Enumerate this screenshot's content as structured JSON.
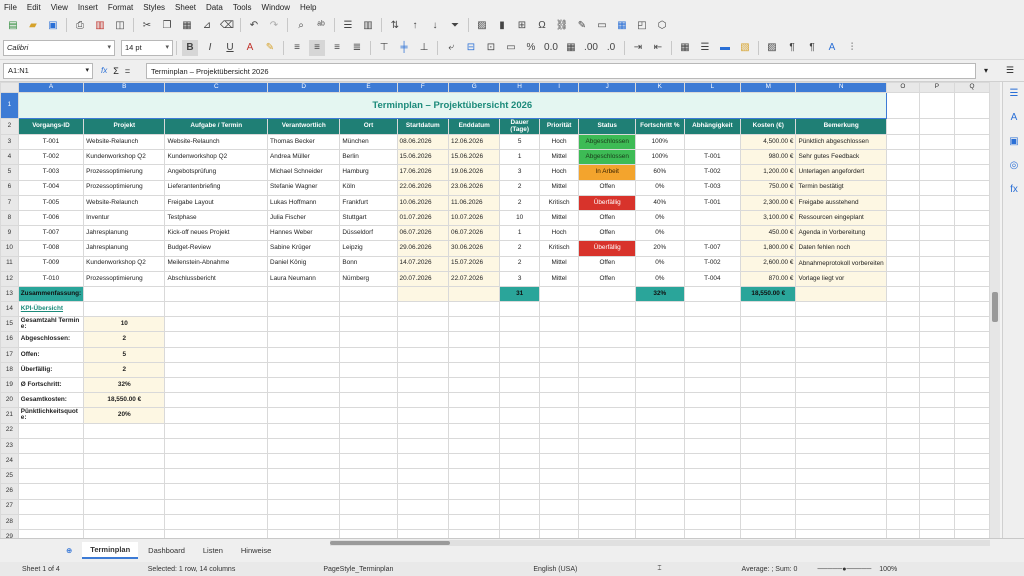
{
  "menu": [
    "File",
    "Edit",
    "View",
    "Insert",
    "Format",
    "Styles",
    "Sheet",
    "Data",
    "Tools",
    "Window",
    "Help"
  ],
  "font": {
    "name": "Calibri",
    "size": "14 pt"
  },
  "name_box": "A1:N1",
  "formula_text": "Terminplan – Projektübersicht 2026",
  "columns": [
    "A",
    "B",
    "C",
    "D",
    "E",
    "F",
    "G",
    "H",
    "I",
    "J",
    "K",
    "L",
    "M",
    "N",
    "O",
    "P",
    "Q"
  ],
  "title": "Terminplan – Projektübersicht 2026",
  "headers": [
    "Vorgangs-ID",
    "Projekt",
    "Aufgabe / Termin",
    "Verantwortlich",
    "Ort",
    "Startdatum",
    "Enddatum",
    "Dauer (Tage)",
    "Priorität",
    "Status",
    "Fortschritt %",
    "Abhängigkeit",
    "Kosten (€)",
    "Bemerkung"
  ],
  "rows": [
    [
      "T-001",
      "Website-Relaunch",
      "Website-Relaunch",
      "Thomas Becker",
      "München",
      "08.06.2026",
      "12.06.2026",
      "5",
      "Hoch",
      "Abgeschlossen",
      "100%",
      "",
      "4,500.00 €",
      "Pünktlich abgeschlossen"
    ],
    [
      "T-002",
      "Kundenworkshop Q2",
      "Kundenworkshop Q2",
      "Andrea Müller",
      "Berlin",
      "15.06.2026",
      "15.06.2026",
      "1",
      "Mittel",
      "Abgeschlossen",
      "100%",
      "T-001",
      "980.00 €",
      "Sehr gutes Feedback"
    ],
    [
      "T-003",
      "Prozessoptimierung",
      "Angebotsprüfung",
      "Michael Schneider",
      "Hamburg",
      "17.06.2026",
      "19.06.2026",
      "3",
      "Hoch",
      "In Arbeit",
      "60%",
      "T-002",
      "1,200.00 €",
      "Unterlagen angefordert"
    ],
    [
      "T-004",
      "Prozessoptimierung",
      "Lieferantenbriefing",
      "Stefanie Wagner",
      "Köln",
      "22.06.2026",
      "23.06.2026",
      "2",
      "Mittel",
      "Offen",
      "0%",
      "T-003",
      "750.00 €",
      "Termin bestätigt"
    ],
    [
      "T-005",
      "Website-Relaunch",
      "Freigabe Layout",
      "Lukas Hoffmann",
      "Frankfurt",
      "10.06.2026",
      "11.06.2026",
      "2",
      "Kritisch",
      "Überfällig",
      "40%",
      "T-001",
      "2,300.00 €",
      "Freigabe ausstehend"
    ],
    [
      "T-006",
      "Inventur",
      "Testphase",
      "Julia Fischer",
      "Stuttgart",
      "01.07.2026",
      "10.07.2026",
      "10",
      "Mittel",
      "Offen",
      "0%",
      "",
      "3,100.00 €",
      "Ressourcen eingeplant"
    ],
    [
      "T-007",
      "Jahresplanung",
      "Kick-off neues Projekt",
      "Hannes Weber",
      "Düsseldorf",
      "06.07.2026",
      "06.07.2026",
      "1",
      "Hoch",
      "Offen",
      "0%",
      "",
      "450.00 €",
      "Agenda in Vorbereitung"
    ],
    [
      "T-008",
      "Jahresplanung",
      "Budget-Review",
      "Sabine Krüger",
      "Leipzig",
      "29.06.2026",
      "30.06.2026",
      "2",
      "Kritisch",
      "Überfällig",
      "20%",
      "T-007",
      "1,800.00 €",
      "Daten fehlen noch"
    ],
    [
      "T-009",
      "Kundenworkshop Q2",
      "Meilenstein-Abnahme",
      "Daniel König",
      "Bonn",
      "14.07.2026",
      "15.07.2026",
      "2",
      "Mittel",
      "Offen",
      "0%",
      "T-002",
      "2,600.00 €",
      "Abnahmeprotokoll vorbereiten"
    ],
    [
      "T-010",
      "Prozessoptimierung",
      "Abschlussbericht",
      "Laura Neumann",
      "Nürnberg",
      "20.07.2026",
      "22.07.2026",
      "3",
      "Mittel",
      "Offen",
      "0%",
      "T-004",
      "870.00 €",
      "Vorlage liegt vor"
    ]
  ],
  "summary": {
    "label": "Zusammenfassung:",
    "dauer": "31",
    "fortschritt": "32%",
    "kosten": "18,550.00 €"
  },
  "kpi": {
    "title": "KPI-Übersicht",
    "items": [
      {
        "label": "Gesamtzahl Termine:",
        "value": "10"
      },
      {
        "label": "Abgeschlossen:",
        "value": "2"
      },
      {
        "label": "Offen:",
        "value": "5"
      },
      {
        "label": "Überfällig:",
        "value": "2"
      },
      {
        "label": "Ø Fortschritt:",
        "value": "32%"
      },
      {
        "label": "Gesamtkosten:",
        "value": "18,550.00 €"
      },
      {
        "label": "Pünktlichkeitsquote:",
        "value": "20%"
      }
    ]
  },
  "tabs": [
    "Terminplan",
    "Dashboard",
    "Listen",
    "Hinweise"
  ],
  "status": {
    "sheet": "Sheet 1 of 4",
    "selection": "Selected: 1 row, 14 columns",
    "pagestyle": "PageStyle_Terminplan",
    "lang": "English (USA)",
    "sum": "Average: ; Sum: 0",
    "zoom": "100%"
  },
  "colors": {
    "header_teal": "#1f7f75",
    "title_bg": "#e4f6f1",
    "done": "#3dbb55",
    "in_progress": "#f3a42d",
    "overdue": "#d8332b",
    "summary": "#2aa59a"
  }
}
